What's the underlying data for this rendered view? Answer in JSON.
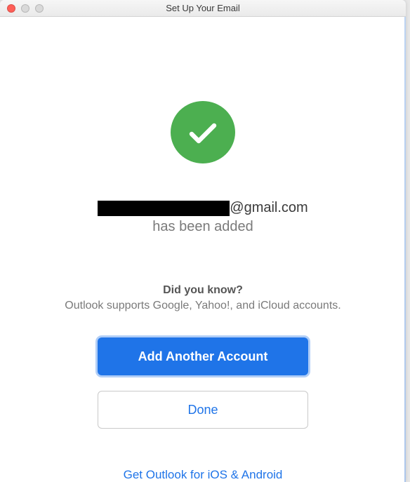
{
  "window": {
    "title": "Set Up Your Email"
  },
  "success": {
    "icon": "checkmark-icon",
    "email_domain": "@gmail.com",
    "added_text": "has been added"
  },
  "tip": {
    "heading": "Did you know?",
    "body": "Outlook supports Google, Yahoo!, and iCloud accounts."
  },
  "buttons": {
    "primary": "Add Another Account",
    "secondary": "Done"
  },
  "footer": {
    "link": "Get Outlook for iOS & Android"
  },
  "colors": {
    "success_green": "#4CAF50",
    "brand_blue": "#1f74e8"
  }
}
